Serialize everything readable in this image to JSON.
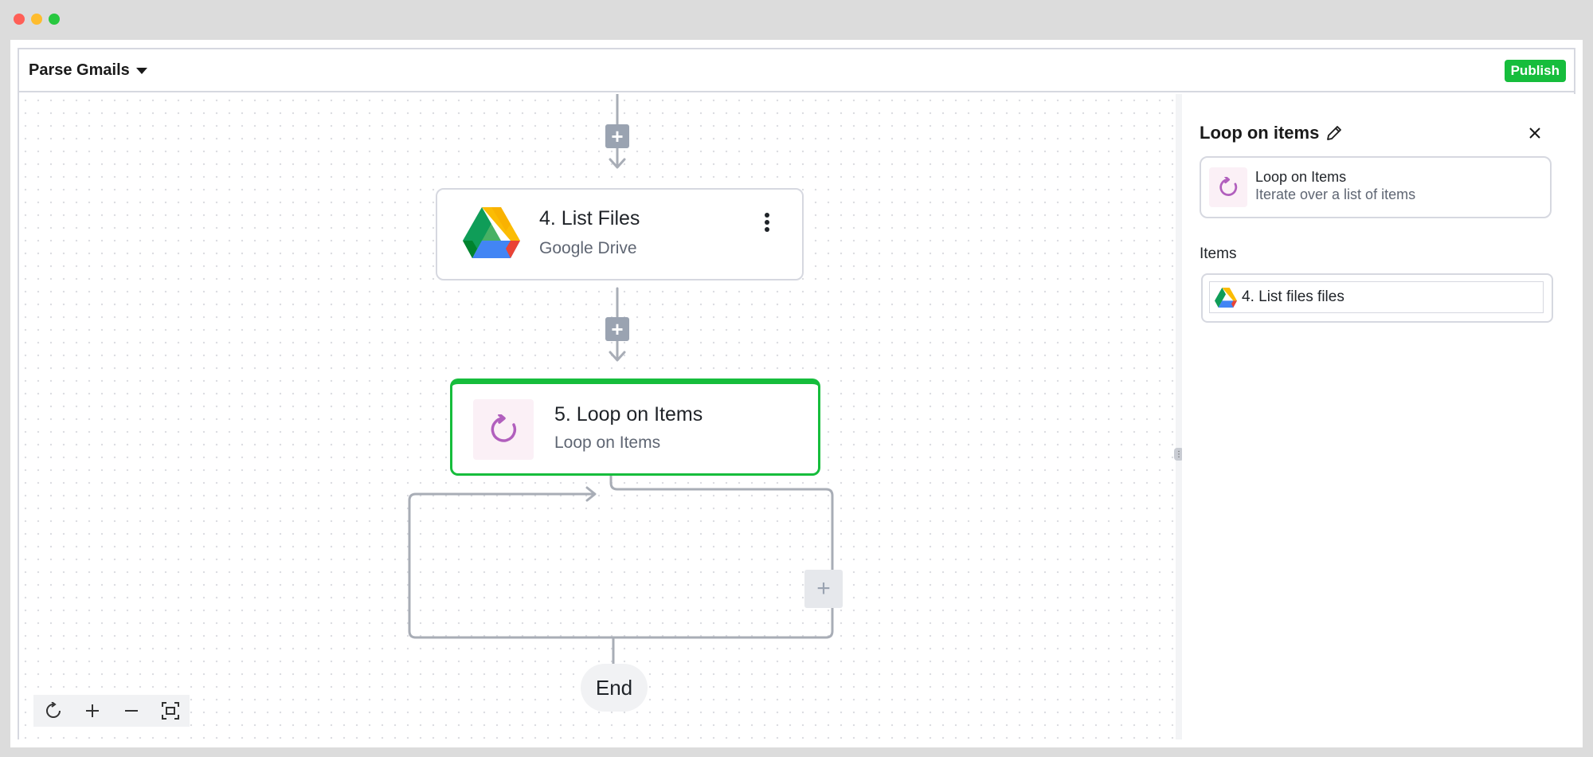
{
  "window": {
    "controls": [
      "close",
      "minimize",
      "maximize"
    ]
  },
  "header": {
    "flow_name": "Parse Gmails",
    "publish_label": "Publish"
  },
  "canvas": {
    "steps": [
      {
        "title": "4. List Files",
        "subtitle": "Google Drive",
        "icon": "google-drive-icon"
      },
      {
        "title": "5. Loop on Items",
        "subtitle": "Loop on Items",
        "icon": "loop-icon",
        "selected": true
      }
    ],
    "end_label": "End",
    "zoom_controls": [
      "reset-icon",
      "zoom-in-icon",
      "zoom-out-icon",
      "fit-view-icon"
    ]
  },
  "panel": {
    "title": "Loop on items",
    "piece": {
      "name": "Loop on Items",
      "description": "Iterate over a list of items"
    },
    "items_label": "Items",
    "items_value": "4. List files files"
  },
  "colors": {
    "accent": "#16bd3c",
    "loop_icon": "#b15fbd",
    "connector": "#9aa3b1"
  }
}
